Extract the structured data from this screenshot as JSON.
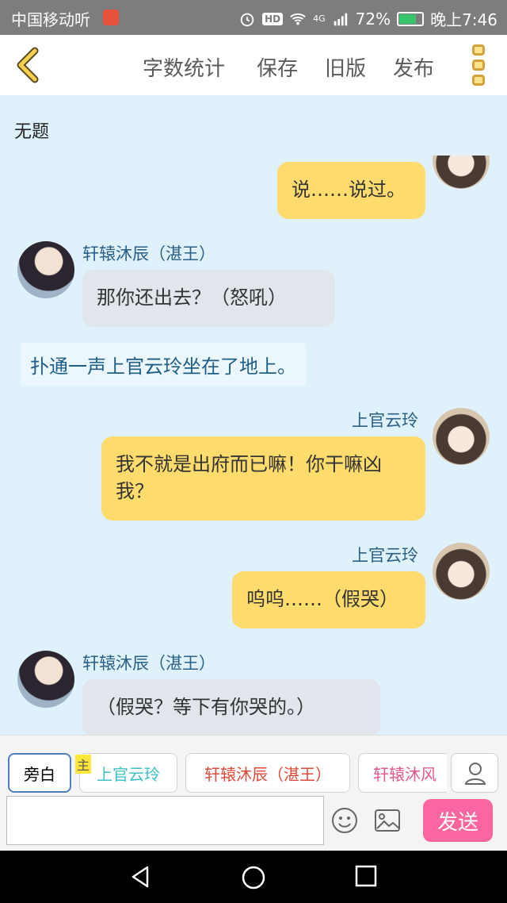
{
  "status_bar": {
    "carrier": "中国移动听",
    "hd": "HD",
    "network": "4G",
    "battery": "72%",
    "time": "晚上7:46"
  },
  "toolbar": {
    "word_count": "字数统计",
    "save": "保存",
    "old_version": "旧版",
    "publish": "发布"
  },
  "document": {
    "title": "无题"
  },
  "messages": [
    {
      "speaker": "",
      "text": "说……说过。"
    },
    {
      "speaker": "轩辕沐辰（湛王）",
      "text": "那你还出去？（怒吼）"
    },
    {
      "speaker": "",
      "text": "扑通一声上官云玲坐在了地上。"
    },
    {
      "speaker": "上官云玲",
      "text": "我不就是出府而已嘛！你干嘛凶我？"
    },
    {
      "speaker": "上官云玲",
      "text": "呜呜……（假哭）"
    },
    {
      "speaker": "轩辕沐辰（湛王）",
      "text": "（假哭？等下有你哭的。）"
    }
  ],
  "roles": [
    {
      "label": "旁白",
      "color": "#333333"
    },
    {
      "label": "上官云玲",
      "color": "#3cc0c8",
      "badge": "主"
    },
    {
      "label": "轩辕沐辰（湛王）",
      "color": "#e04a3a"
    },
    {
      "label": "轩辕沐风",
      "color": "#e0588f"
    }
  ],
  "composer": {
    "placeholder": "",
    "send_label": "发送"
  },
  "icons": [
    "back-chevron-icon",
    "menu-dots-icon",
    "person-icon",
    "emoji-icon",
    "image-icon",
    "android-back-icon",
    "android-home-icon",
    "android-recents-icon"
  ],
  "colors": {
    "accent": "#fb66a0",
    "bubble_right": "#fddb6d",
    "bubble_left": "#e1e5ec",
    "name_text": "#2b5f86"
  }
}
